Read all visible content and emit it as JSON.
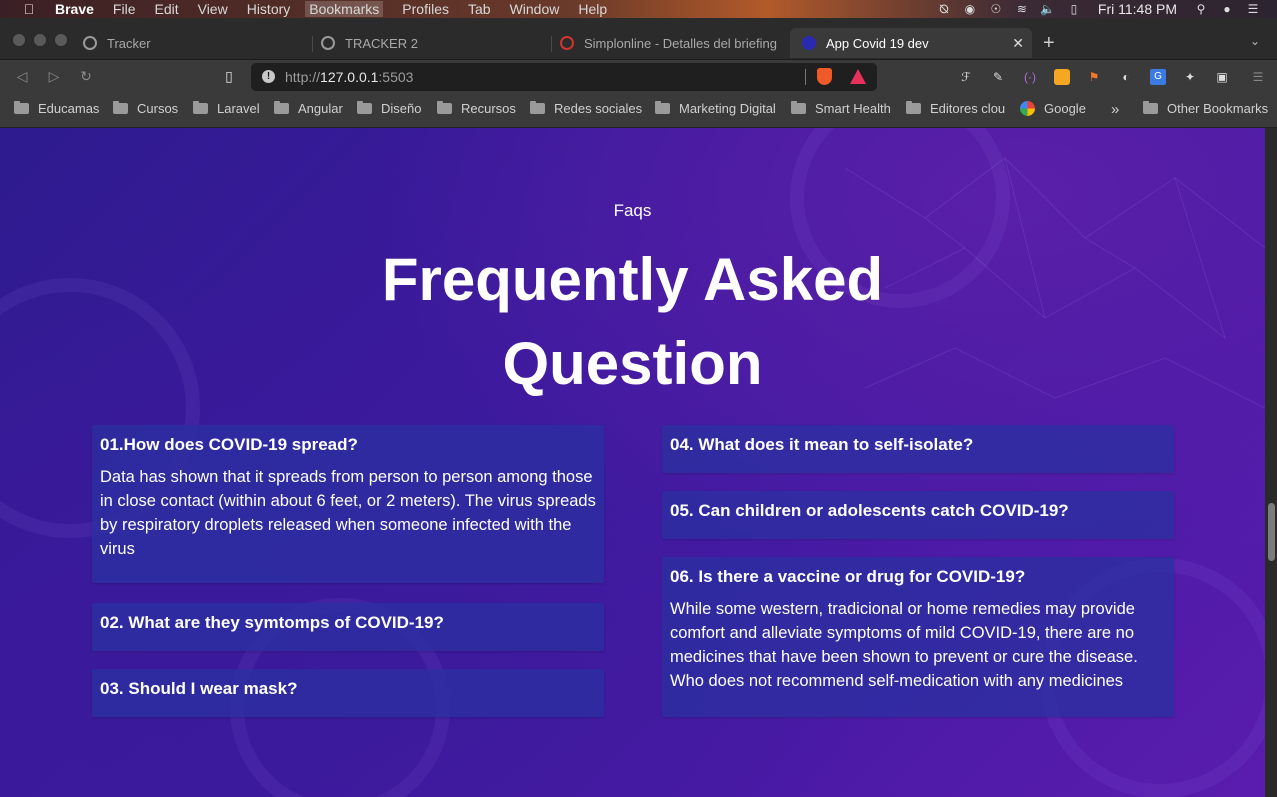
{
  "menubar": {
    "app_name": "Brave",
    "items": [
      "File",
      "Edit",
      "View",
      "History",
      "Bookmarks",
      "Profiles",
      "Tab",
      "Window",
      "Help"
    ],
    "clock": "Fri 11:48 PM"
  },
  "tabs": [
    {
      "title": "Tracker"
    },
    {
      "title": "TRACKER 2"
    },
    {
      "title": "Simplonline - Detalles del briefing"
    },
    {
      "title": "App Covid 19 dev"
    }
  ],
  "address": {
    "scheme": "http://",
    "host": "127.0.0.1",
    "port": ":5503"
  },
  "bookmarks": [
    "Educamas",
    "Cursos",
    "Laravel",
    "Angular",
    "Diseño",
    "Recursos",
    "Redes sociales",
    "Marketing Digital",
    "Smart Health",
    "Editores clou",
    "Google",
    "Other Bookmarks"
  ],
  "faq": {
    "eyebrow": "Faqs",
    "title_line1": "Frequently Asked",
    "title_line2": "Question",
    "items": [
      {
        "q": "01.How does COVID-19 spread?",
        "a": "Data has shown that it spreads from person to person among those in close contact (within about 6 feet, or 2 meters). The virus spreads by respiratory droplets released when someone infected with the virus"
      },
      {
        "q": "02. What are they symtomps of COVID-19?"
      },
      {
        "q": "03. Should I wear mask?"
      },
      {
        "q": "04. What does it mean to self-isolate?"
      },
      {
        "q": "05. Can children or adolescents catch COVID-19?"
      },
      {
        "q": "06. Is there a vaccine or drug for COVID-19?",
        "a": "While some western, tradicional or home remedies may provide comfort and alleviate symptoms of mild COVID-19, there are no medicines that have been shown to prevent or cure the disease. Who does not recommend self-medication with any medicines"
      }
    ]
  }
}
